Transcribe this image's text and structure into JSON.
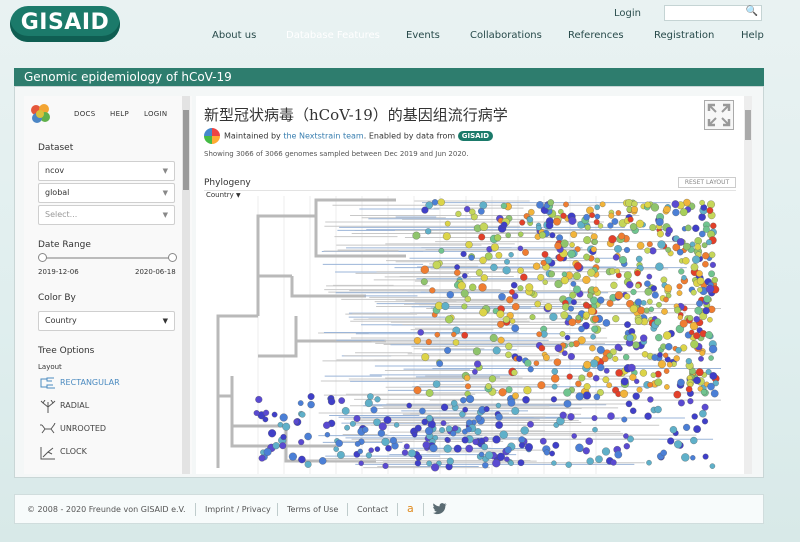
{
  "header": {
    "logo_text": "GISAID",
    "login": "Login",
    "nav": [
      {
        "label": "About us"
      },
      {
        "label": "Database Features"
      },
      {
        "label": "Events"
      },
      {
        "label": "Collaborations"
      },
      {
        "label": "References"
      },
      {
        "label": "Registration"
      },
      {
        "label": "Help"
      }
    ],
    "active_nav": "Database Features"
  },
  "page_title": "Genomic epidemiology of hCoV-19",
  "sidebar": {
    "links": [
      "DOCS",
      "HELP",
      "LOGIN"
    ],
    "dataset_heading": "Dataset",
    "dataset_values": [
      "ncov",
      "global"
    ],
    "dataset_placeholder": "Select...",
    "date_range_heading": "Date Range",
    "date_start": "2019-12-06",
    "date_end": "2020-06-18",
    "color_by_heading": "Color By",
    "color_by_value": "Country",
    "tree_options_heading": "Tree Options",
    "layout_label": "Layout",
    "layouts": [
      "RECTANGULAR",
      "RADIAL",
      "UNROOTED",
      "CLOCK"
    ],
    "active_layout": "RECTANGULAR"
  },
  "main": {
    "title": "新型冠状病毒（hCoV-19）的基因组流行病学",
    "maintained_prefix": "Maintained by ",
    "maintained_link": "the Nextstrain team",
    "maintained_suffix": ". Enabled by data from ",
    "data_badge": "GISAID",
    "showing": "Showing 3066 of 3066 genomes sampled between Dec 2019 and Jun 2020.",
    "phylogeny_label": "Phylogeny",
    "phylogeny_select": "Country",
    "reset_layout": "RESET LAYOUT"
  },
  "footer": {
    "copyright": "© 2008 - 2020   Freunde von GISAID e.V.",
    "imprint": "Imprint / Privacy",
    "terms": "Terms of Use",
    "contact": "Contact"
  },
  "colors": {
    "brand": "#1b7a6a",
    "title_bar": "#2e7d6e",
    "link": "#3a7fb0",
    "active_layout": "#4a8ac0"
  }
}
